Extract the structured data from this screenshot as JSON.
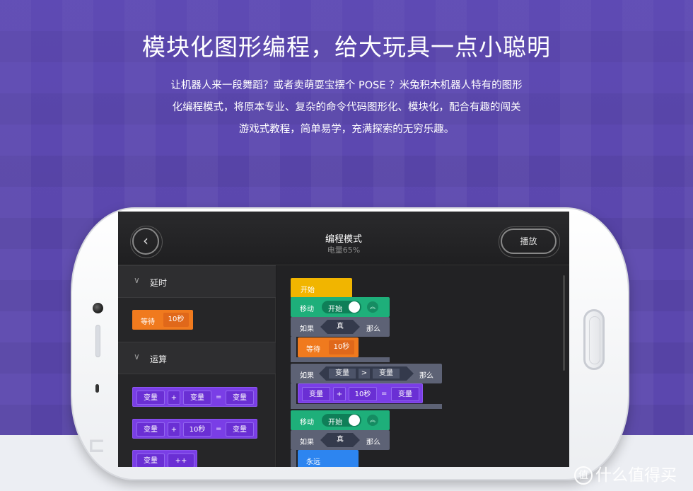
{
  "headline": "模块化图形编程，给大玩具一点小聪明",
  "description": [
    "让机器人来一段舞蹈？或者卖萌耍宝摆个 POSE ？米兔积木机器人特有的图形",
    "化编程模式，将原本专业、复杂的命令代码图形化、模块化，配合有趣的闯关",
    "游戏式教程，简单易学，充满探索的无穷乐趣。"
  ],
  "app": {
    "title": "编程模式",
    "battery": "电量65%",
    "play_label": "播放",
    "back_icon": "back-arrow-icon"
  },
  "sidebar": {
    "categories": [
      {
        "label": "延时",
        "icon": "chevron-down-icon"
      },
      {
        "label": "运算",
        "icon": "chevron-down-icon"
      }
    ],
    "wait_block": {
      "label": "等待",
      "value": "10秒"
    },
    "op_blocks": [
      {
        "a": "变量",
        "op": "+",
        "b": "变量",
        "eq": "=",
        "c": "变量"
      },
      {
        "a": "变量",
        "op": "+",
        "b": "10秒",
        "eq": "=",
        "c": "变量"
      },
      {
        "a": "变量",
        "op": "++"
      }
    ]
  },
  "program": {
    "start": "开始",
    "move1": {
      "label": "移动",
      "toggle": "开始",
      "icon": "double-chevron-up-icon"
    },
    "if1": {
      "label": "如果",
      "cond": "真",
      "then": "那么"
    },
    "wait": {
      "label": "等待",
      "value": "10秒"
    },
    "if2": {
      "label": "如果",
      "left": "变量",
      "op": ">",
      "right": "变量",
      "then": "那么"
    },
    "assign": {
      "a": "变量",
      "op": "+",
      "b": "10秒",
      "eq": "=",
      "c": "变量"
    },
    "move2": {
      "label": "移动",
      "toggle": "开始",
      "icon": "double-chevron-up-icon"
    },
    "if3": {
      "label": "如果",
      "cond": "真",
      "then": "那么"
    },
    "forever": "永远"
  },
  "watermark": {
    "logo": "值",
    "text": "什么值得买"
  },
  "colors": {
    "background": "#5b47ae",
    "purple_block": "#7a3ee6",
    "orange_block": "#f07a1e",
    "yellow_block": "#f1b500",
    "green_block": "#1eaf7a",
    "gray_block": "#5d6275",
    "blue_block": "#2d85f0"
  }
}
